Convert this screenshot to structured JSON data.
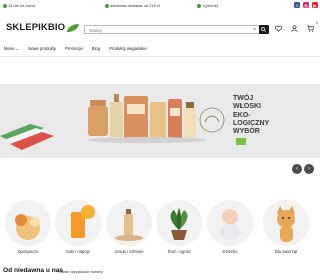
{
  "topbar": {
    "item1": "14 dni na zwrot",
    "item2": "darmowa dostawa od 249 zł",
    "item3": "+(phone)"
  },
  "header": {
    "logo": "SKLEPIKBIO",
    "search_placeholder": "Szukaj",
    "search_clear": "×",
    "cart_count": "0"
  },
  "nav": {
    "items": [
      "Menu",
      "Nowe produkty",
      "Promocje",
      "Blog",
      "Produkty wegańskie"
    ]
  },
  "banner": {
    "line1": "Twój",
    "line2": "włoski",
    "line3": "eko-",
    "line4": "logiczny",
    "line5": "wybór",
    "prev": "‹",
    "next": "›"
  },
  "categories": [
    {
      "label": "Spożywcze"
    },
    {
      "label": "Soki i napoje"
    },
    {
      "label": "Uroda i zdrowie"
    },
    {
      "label": "Dom i ogród"
    },
    {
      "label": "Dziecko"
    },
    {
      "label": "Dla zwierząt"
    }
  ],
  "section": {
    "title": "Od niedawna u nas",
    "subtitle": "Nowe wysyłkowe towary!"
  },
  "colors": {
    "accent_green": "#4a9b3a",
    "dark": "#1a1a1a",
    "banner_bg": "#e9e9e9"
  }
}
